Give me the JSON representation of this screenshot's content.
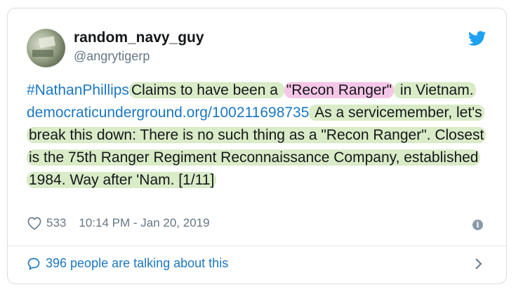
{
  "tweet": {
    "display_name": "random_navy_guy",
    "handle": "@angrytigerp",
    "segments": {
      "hashtag": "#NathanPhillips",
      "s1": "Claims to have been a ",
      "quote": "\"Recon Ranger\"",
      "s2": " in Vietnam.",
      "link": "democraticunderground.org/100211698735",
      "s3": " As a servicemember, let's break this down: There is no such thing as a \"Recon Ranger\". Closest is the 75th Ranger Regiment Reconnaissance Company, established 1984. Way after 'Nam. [1/11]"
    },
    "likes": "533",
    "timestamp": "10:14 PM - Jan 20, 2019",
    "talking": "396 people are talking about this"
  },
  "icons": {
    "bird": "twitter-bird-icon",
    "heart": "heart-icon",
    "info": "info-icon",
    "bubble": "speech-bubble-icon",
    "chevron": "chevron-right-icon"
  },
  "colors": {
    "link": "#1b77c2",
    "green_highlight": "#d9ebc7",
    "pink_highlight": "#f6c6e8",
    "twitter_blue": "#1da1f2"
  }
}
